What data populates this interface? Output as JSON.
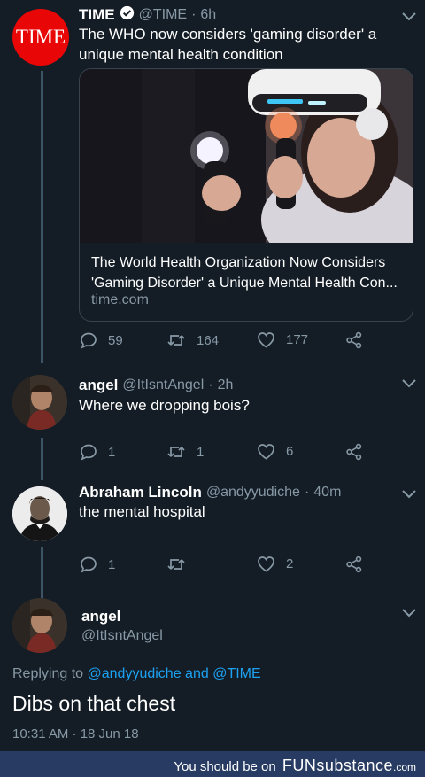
{
  "tweet1": {
    "name": "TIME",
    "handle": "@TIME",
    "sep": "·",
    "time": "6h",
    "avatar_text": "TIME",
    "text": "The WHO now considers 'gaming disorder' a unique mental health condition",
    "card": {
      "title": "The World Health Organization Now Considers 'Gaming Disorder' a Unique Mental Health Con...",
      "domain": "time.com"
    },
    "actions": {
      "replies": "59",
      "retweets": "164",
      "likes": "177"
    }
  },
  "tweet2": {
    "name": "angel",
    "handle": "@ItIsntAngel",
    "sep": "·",
    "time": "2h",
    "text": "Where we dropping bois?",
    "actions": {
      "replies": "1",
      "retweets": "1",
      "likes": "6"
    }
  },
  "tweet3": {
    "name": "Abraham Lincoln",
    "handle": "@andyyudiche",
    "sep": "·",
    "time": "40m",
    "text": "the mental hospital",
    "actions": {
      "replies": "1",
      "retweets": "",
      "likes": "2"
    }
  },
  "tweet4": {
    "name": "angel",
    "handle": "@ItIsntAngel",
    "replying_prefix": "Replying to",
    "reply_user1": "@andyyudiche",
    "reply_and": "and",
    "reply_user2": "@TIME",
    "text": "Dibs on that chest",
    "timestamp": "10:31 AM · 18 Jun 18"
  },
  "footer": {
    "prefix": "You should be on",
    "brand": "FUNsubstance",
    "suffix": ".com"
  },
  "colors": {
    "background": "#141d26",
    "link": "#1da1f2",
    "muted": "#8899a6",
    "time_red": "#e90606",
    "footer": "#273b63"
  }
}
